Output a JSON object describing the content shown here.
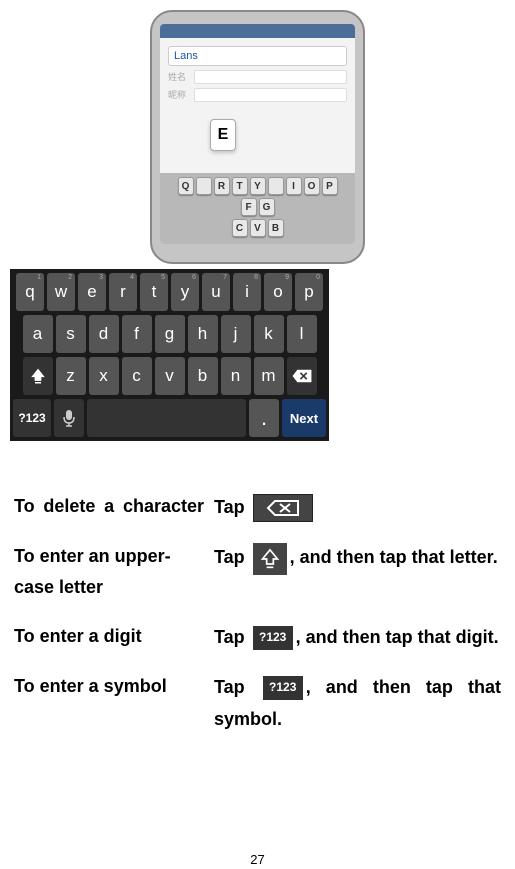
{
  "phone": {
    "input_text": "Lans",
    "callout_letter": "E",
    "row1": [
      "Q",
      "",
      "R",
      "T",
      "Y",
      "",
      "I",
      "O",
      "P"
    ],
    "row2": [
      "F",
      "G"
    ],
    "row3": [
      "C",
      "V",
      "B"
    ]
  },
  "keyboard": {
    "row1": [
      {
        "label": "q",
        "sup": "1"
      },
      {
        "label": "w",
        "sup": "2"
      },
      {
        "label": "e",
        "sup": "3"
      },
      {
        "label": "r",
        "sup": "4"
      },
      {
        "label": "t",
        "sup": "5"
      },
      {
        "label": "y",
        "sup": "6"
      },
      {
        "label": "u",
        "sup": "7"
      },
      {
        "label": "i",
        "sup": "8"
      },
      {
        "label": "o",
        "sup": "9"
      },
      {
        "label": "p",
        "sup": "0"
      }
    ],
    "row2": [
      "a",
      "s",
      "d",
      "f",
      "g",
      "h",
      "j",
      "k",
      "l"
    ],
    "row3": [
      "z",
      "x",
      "c",
      "v",
      "b",
      "n",
      "m"
    ],
    "mode_label": "?123",
    "dot_label": ".",
    "next_label": "Next"
  },
  "instructions": {
    "r1": {
      "left": "To delete a character",
      "tap": "Tap"
    },
    "r2": {
      "left": "To enter an upper-case letter",
      "tap": "Tap ",
      "tail": ", and then tap that letter."
    },
    "r3": {
      "left": "To enter a digit",
      "tap": "Tap ",
      "mode": "?123",
      "tail": ", and then tap that digit."
    },
    "r4": {
      "left": "To enter a symbol",
      "tap": "Tap ",
      "mode": "?123",
      "tail": ", and then tap that symbol."
    }
  },
  "page_number": "27"
}
